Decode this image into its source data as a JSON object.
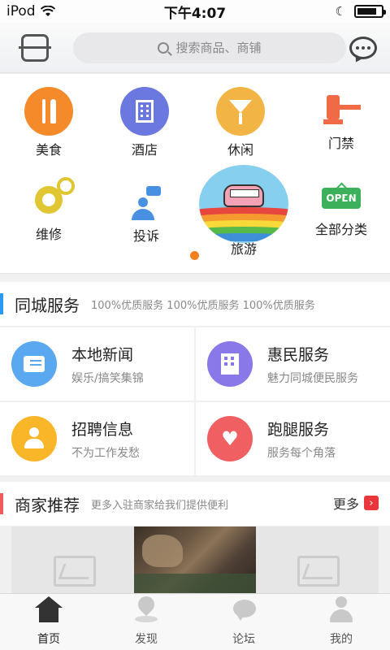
{
  "status": {
    "carrier": "iPod",
    "time": "下午4:07"
  },
  "header": {
    "search_placeholder": "搜索商品、商铺"
  },
  "categories": [
    {
      "label": "美食",
      "icon": "fork-knife-icon",
      "color": "#f48a2a"
    },
    {
      "label": "酒店",
      "icon": "building-icon",
      "color": "#6b78e0"
    },
    {
      "label": "休闲",
      "icon": "cocktail-icon",
      "color": "#f2b445"
    },
    {
      "label": "门禁",
      "icon": "gate-barrier-icon",
      "color": "#f06b45"
    },
    {
      "label": "维修",
      "icon": "gear-icon",
      "color": "#e0c632"
    },
    {
      "label": "投诉",
      "icon": "complaint-icon",
      "color": "#4a90e2"
    },
    {
      "label": "旅游",
      "icon": "travel-bus-icon",
      "color": "#87cfef"
    },
    {
      "label": "全部分类",
      "icon": "open-sign-icon",
      "open_text": "OPEN",
      "color": "#3cb05a"
    }
  ],
  "city_service": {
    "title": "同城服务",
    "subtitle": "100%优质服务 100%优质服务 100%优质服务",
    "accent": "#2b9af3",
    "items": [
      {
        "name": "本地新闻",
        "desc": "娱乐/搞笑集锦",
        "icon": "newspaper-icon",
        "color": "#5aa8f0"
      },
      {
        "name": "惠民服务",
        "desc": "魅力同城便民服务",
        "icon": "city-building-icon",
        "color": "#8878e8"
      },
      {
        "name": "招聘信息",
        "desc": "不为工作发愁",
        "icon": "user-icon",
        "color": "#f8b628"
      },
      {
        "name": "跑腿服务",
        "desc": "服务每个角落",
        "icon": "heart-location-icon",
        "heart_glyph": "♥",
        "color": "#f05f62"
      }
    ]
  },
  "merchant": {
    "title": "商家推荐",
    "subtitle": "更多入驻商家给我们提供便利",
    "accent": "#f05a5a",
    "more_label": "更多",
    "more_glyph": "›"
  },
  "tabs": [
    {
      "label": "首页",
      "icon": "home-icon",
      "active": true
    },
    {
      "label": "发现",
      "icon": "location-pin-icon",
      "active": false
    },
    {
      "label": "论坛",
      "icon": "forum-bubble-icon",
      "active": false
    },
    {
      "label": "我的",
      "icon": "profile-icon",
      "active": false
    }
  ]
}
